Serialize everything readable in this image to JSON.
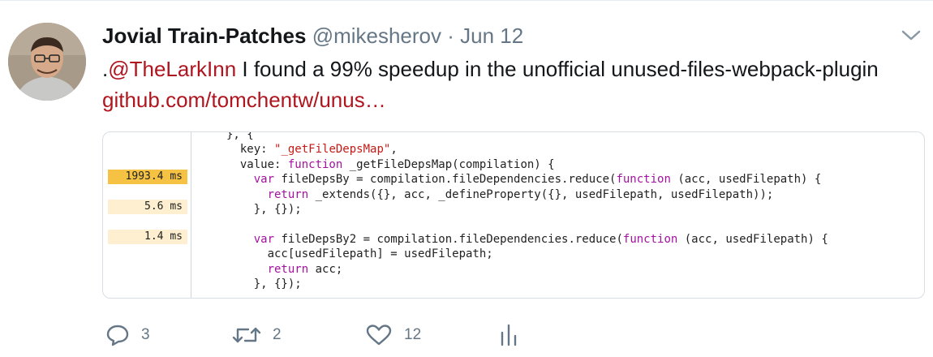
{
  "tweet": {
    "display_name": "Jovial Train-Patches",
    "handle": "@mikesherov",
    "separator": "·",
    "date": "Jun 12",
    "text_prefix": ".",
    "mention": "@TheLarkInn",
    "text_body": " I found a 99% speedup in the unofficial unused-files-webpack-plugin ",
    "link": "github.com/tomchentw/unus…"
  },
  "card": {
    "timings": [
      {
        "label": "1993.4 ms",
        "fraction": 1.0,
        "color": "#f5c244"
      },
      {
        "label": "5.6 ms",
        "fraction": 1.0,
        "color": "#fdefcf"
      },
      {
        "label": "1.4 ms",
        "fraction": 1.0,
        "color": "#fdefcf"
      }
    ],
    "code": {
      "l0": "}, {",
      "l1a": "  key: ",
      "l1b": "\"_getFileDepsMap\"",
      "l1c": ",",
      "l2a": "  value: ",
      "l2b": "function",
      "l2c": " _getFileDepsMap(compilation) {",
      "l3a": "    ",
      "l3b": "var",
      "l3c": " fileDepsBy = compilation.fileDependencies.reduce(",
      "l3d": "function",
      "l3e": " (acc, usedFilepath) {",
      "l4a": "      ",
      "l4b": "return",
      "l4c": " _extends({}, acc, _defineProperty({}, usedFilepath, usedFilepath));",
      "l5": "    }, {});",
      "l6": "",
      "l7a": "    ",
      "l7b": "var",
      "l7c": " fileDepsBy2 = compilation.fileDependencies.reduce(",
      "l7d": "function",
      "l7e": " (acc, usedFilepath) {",
      "l8": "      acc[usedFilepath] = usedFilepath;",
      "l9a": "      ",
      "l9b": "return",
      "l9c": " acc;",
      "l10": "    }, {});"
    }
  },
  "actions": {
    "reply_count": "3",
    "retweet_count": "2",
    "like_count": "12"
  },
  "colors": {
    "link": "#b0151f",
    "secondary_text": "#657786",
    "keyword": "#a4119f",
    "string": "#c41a16"
  },
  "icons": [
    "chevron-down-icon",
    "reply-icon",
    "retweet-icon",
    "heart-icon",
    "analytics-icon"
  ]
}
